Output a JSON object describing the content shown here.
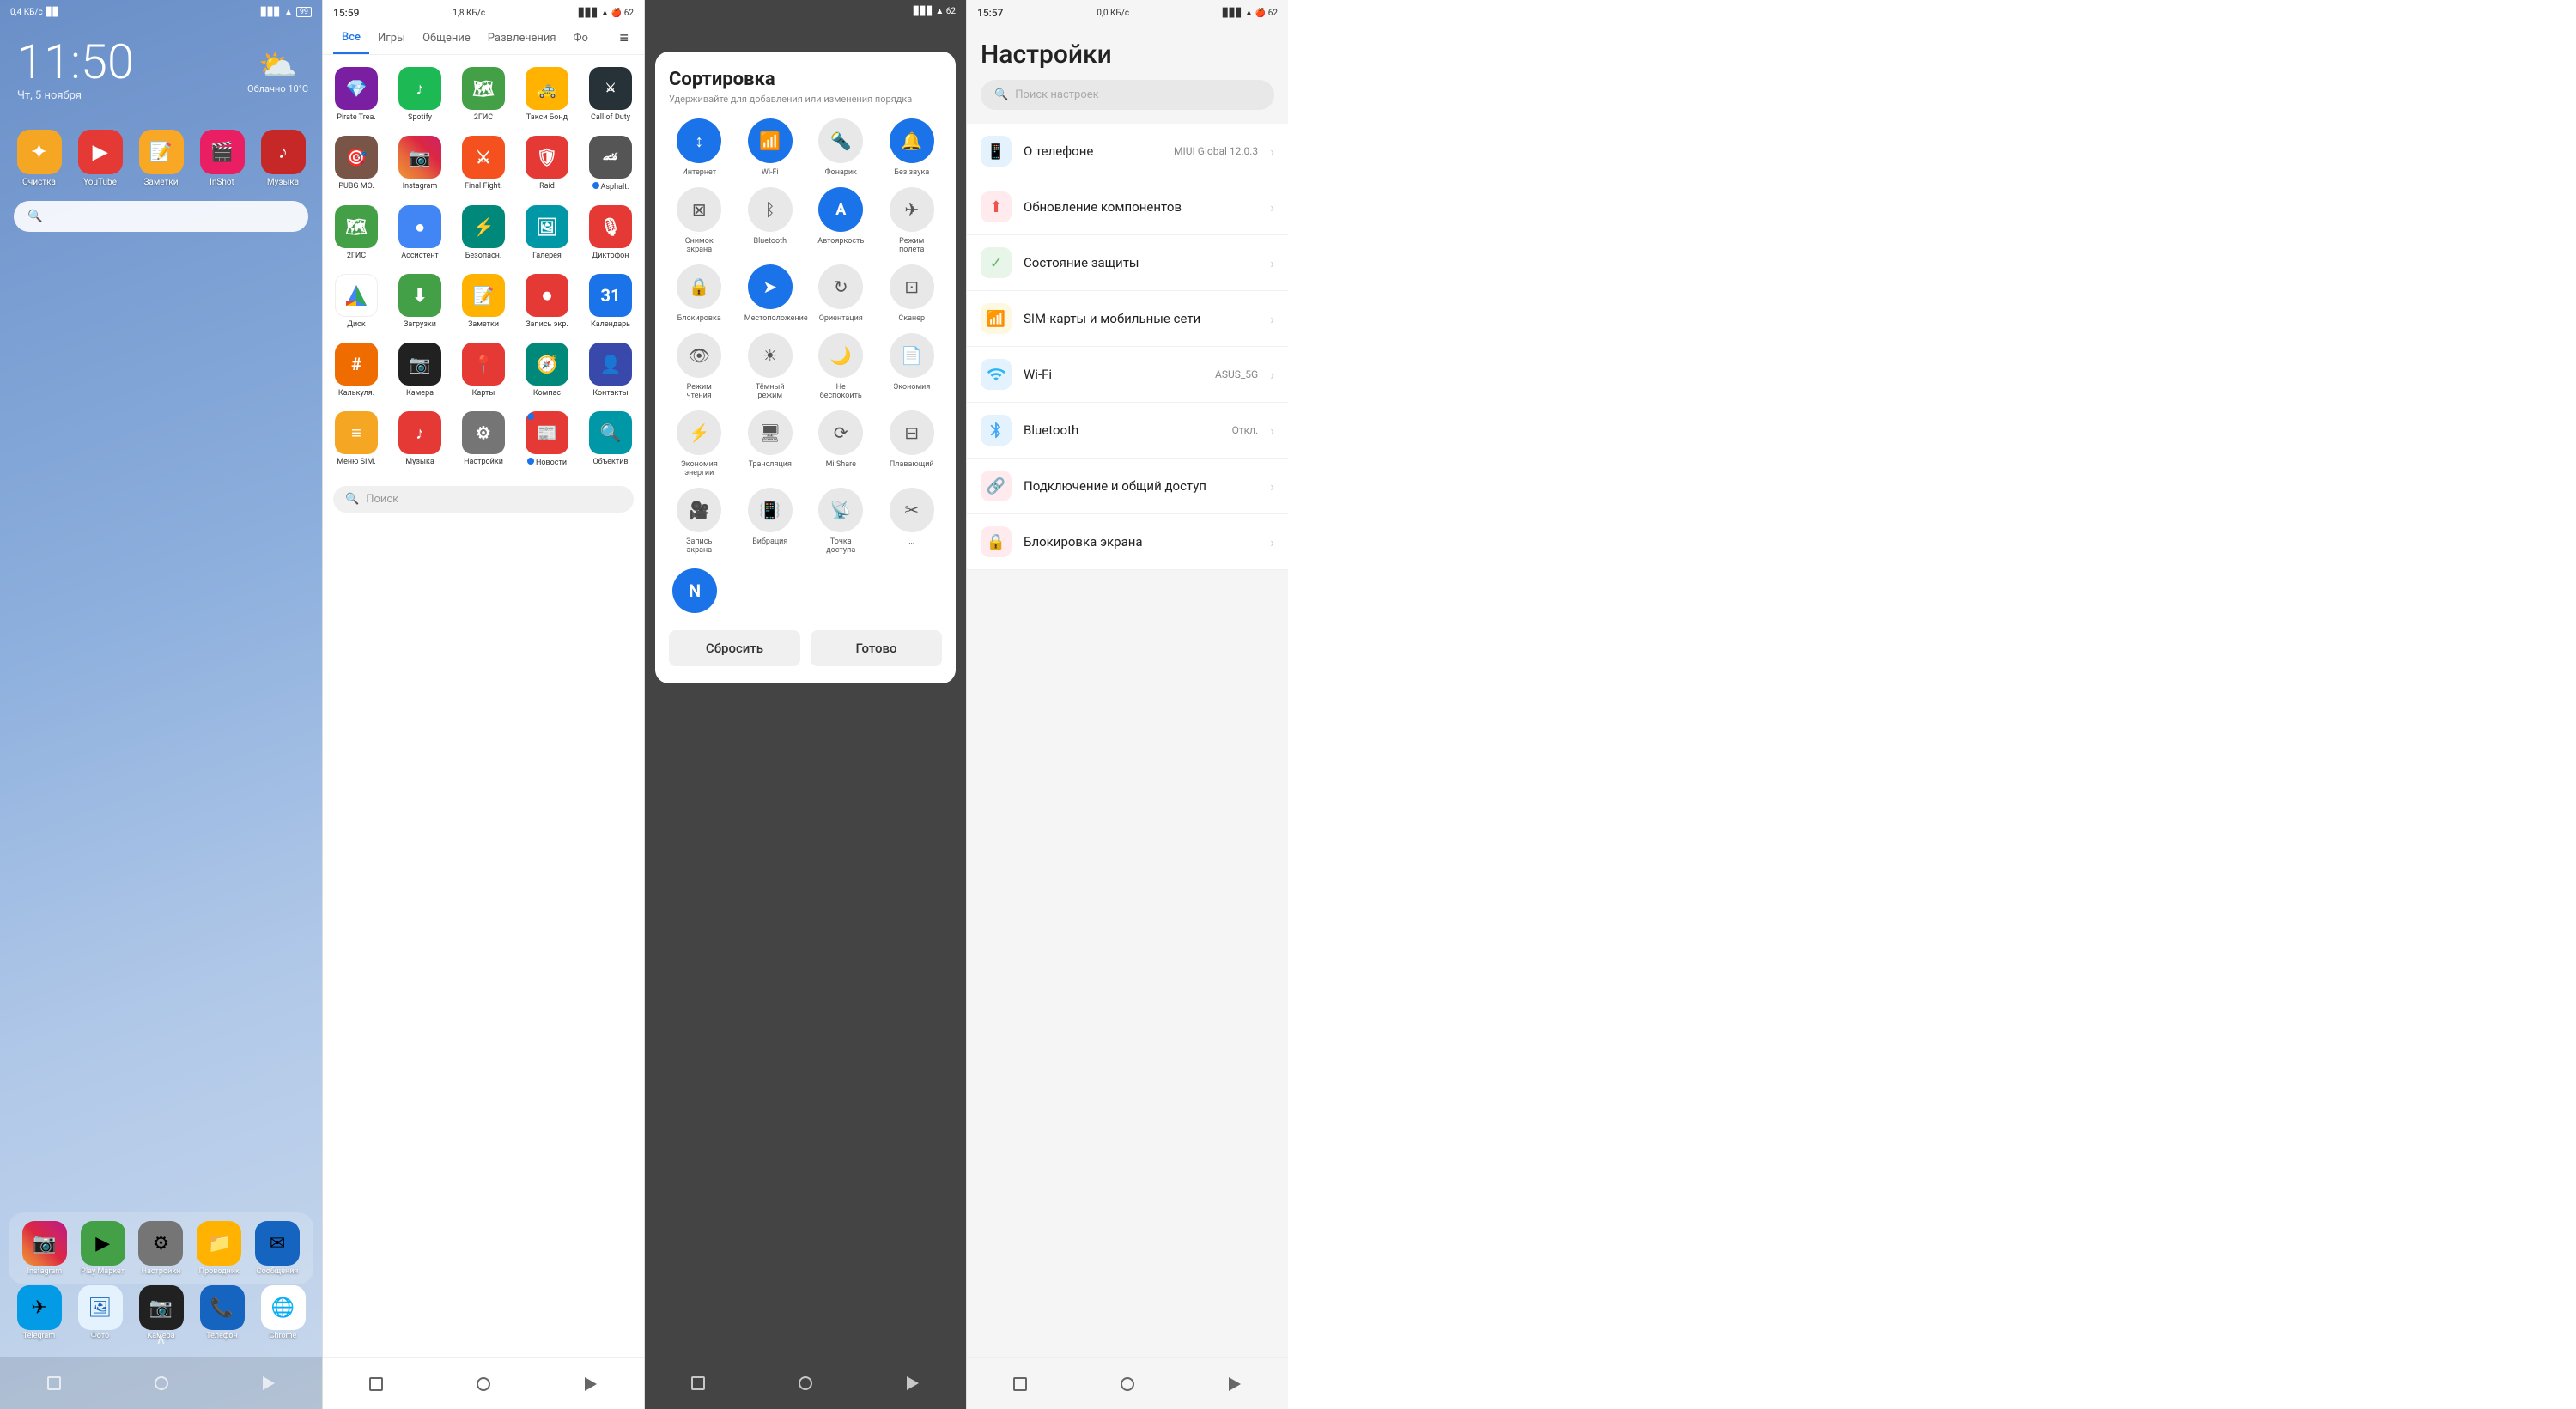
{
  "screen1": {
    "statusBar": {
      "left": "0,4 КБ/с",
      "time": "11:50",
      "date": "Чт, 5 ноября",
      "weather": "Облачно 10°C"
    },
    "clock": "11:50",
    "date": "Чт, 5 ноября",
    "weather": {
      "icon": "⛅",
      "text": "Облачно 10°C"
    },
    "apps": [
      {
        "name": "Очистка",
        "color": "icon-orange",
        "icon": "✦"
      },
      {
        "name": "YouTube",
        "color": "icon-red",
        "icon": "▶"
      },
      {
        "name": "Заметки",
        "color": "icon-yellow",
        "icon": "📝"
      },
      {
        "name": "InShot",
        "color": "icon-pink-red",
        "icon": "🎬"
      },
      {
        "name": "Музыка",
        "color": "icon-dark-red",
        "icon": "♪"
      }
    ],
    "searchPlaceholder": "🔍",
    "dock": [
      {
        "name": "Instagram",
        "color": "icon-pink-red",
        "icon": "📷"
      },
      {
        "name": "Play Маркет",
        "color": "icon-green",
        "icon": "▶"
      },
      {
        "name": "Настройки",
        "color": "icon-grey",
        "icon": "⚙"
      },
      {
        "name": "Проводник",
        "color": "icon-amber",
        "icon": "📁"
      },
      {
        "name": "Сообщения",
        "color": "icon-blue",
        "icon": "✉"
      }
    ],
    "bottom": [
      {
        "name": "Telegram",
        "color": "icon-light-blue",
        "icon": "✈"
      },
      {
        "name": "Фото",
        "color": "icon-blue",
        "icon": "🖼"
      },
      {
        "name": "Камера",
        "color": "icon-grey",
        "icon": "📷"
      },
      {
        "name": "Телефон",
        "color": "icon-blue",
        "icon": "📞"
      },
      {
        "name": "Chrome",
        "color": "icon-red",
        "icon": "🌐"
      }
    ]
  },
  "screen2": {
    "statusBar": {
      "time": "15:59",
      "traffic": "1,8 КБ/с"
    },
    "tabs": [
      {
        "label": "Все",
        "active": true
      },
      {
        "label": "Игры",
        "active": false
      },
      {
        "label": "Общение",
        "active": false
      },
      {
        "label": "Развлечения",
        "active": false
      },
      {
        "label": "Фо",
        "active": false
      }
    ],
    "apps": [
      {
        "name": "Pirate Trea.",
        "color": "icon-purple",
        "icon": "💎"
      },
      {
        "name": "Spotify",
        "color": "icon-spotify",
        "icon": "♪"
      },
      {
        "name": "2ГИС",
        "color": "icon-green",
        "icon": "🗺"
      },
      {
        "name": "Такси Бонд",
        "color": "icon-amber",
        "icon": "🚕"
      },
      {
        "name": "Call of Duty",
        "color": "icon-dark-green",
        "icon": "🎮"
      },
      {
        "name": "PUBG MO.",
        "color": "icon-brown",
        "icon": "🎯"
      },
      {
        "name": "Instagram",
        "color": "icon-pink-red",
        "icon": "📷"
      },
      {
        "name": "Final Fight.",
        "color": "icon-deep-orange",
        "icon": "⚔"
      },
      {
        "name": "Raid",
        "color": "icon-red",
        "icon": "🛡"
      },
      {
        "name": "• Asphalt.",
        "color": "icon-grey",
        "icon": "🏎"
      },
      {
        "name": "2ГИС",
        "color": "icon-green",
        "icon": "🗺"
      },
      {
        "name": "Ассистент",
        "color": "icon-indigo",
        "icon": "●"
      },
      {
        "name": "Безопасн.",
        "color": "icon-teal",
        "icon": "⚡"
      },
      {
        "name": "Галерея",
        "color": "icon-cyan",
        "icon": "🖼"
      },
      {
        "name": "Диктофон",
        "color": "icon-red",
        "icon": "🎙"
      },
      {
        "name": "Диск",
        "color": "icon-green",
        "icon": "△"
      },
      {
        "name": "Загрузки",
        "color": "icon-green",
        "icon": "⬇"
      },
      {
        "name": "Заметки",
        "color": "icon-amber",
        "icon": "📝"
      },
      {
        "name": "Запись экр.",
        "color": "icon-red",
        "icon": "⏺"
      },
      {
        "name": "Календарь",
        "color": "icon-blue",
        "icon": "31"
      },
      {
        "name": "Калькуля.",
        "color": "icon-orange-deep",
        "icon": "#"
      },
      {
        "name": "Камера",
        "color": "icon-grey",
        "icon": "📷"
      },
      {
        "name": "Карты",
        "color": "icon-red",
        "icon": "📍"
      },
      {
        "name": "Компас",
        "color": "icon-teal",
        "icon": "🧭"
      },
      {
        "name": "Контакты",
        "color": "icon-indigo",
        "icon": "👤"
      },
      {
        "name": "Меню SIM.",
        "color": "icon-orange",
        "icon": "≡"
      },
      {
        "name": "Музыка",
        "color": "icon-red",
        "icon": "♪"
      },
      {
        "name": "Настройки",
        "color": "icon-grey",
        "icon": "⚙"
      },
      {
        "name": "• Новости",
        "color": "icon-red",
        "icon": "📰"
      },
      {
        "name": "Объектив",
        "color": "icon-cyan",
        "icon": "🔍"
      }
    ],
    "searchPlaceholder": "Поиск"
  },
  "screen3": {
    "title": "Сортировка",
    "subtitle": "Удерживайте для добавления или изменения порядка",
    "tiles": [
      {
        "label": "Интернет",
        "active": true,
        "icon": "↕"
      },
      {
        "label": "Wi-Fi",
        "active": true,
        "icon": "📶"
      },
      {
        "label": "Фонарик",
        "active": false,
        "icon": "🔦"
      },
      {
        "label": "Без звука",
        "active": true,
        "icon": "🔔"
      },
      {
        "label": "Снимок экрана",
        "active": false,
        "icon": "⊠"
      },
      {
        "label": "Bluetooth",
        "active": false,
        "icon": "ᛒ"
      },
      {
        "label": "Автояркость",
        "active": true,
        "icon": "A"
      },
      {
        "label": "Режим полета",
        "active": false,
        "icon": "✈"
      },
      {
        "label": "Блокировка",
        "active": false,
        "icon": "🔒"
      },
      {
        "label": "Местоположение",
        "active": true,
        "icon": "➤"
      },
      {
        "label": "Ориентация",
        "active": false,
        "icon": "↻"
      },
      {
        "label": "Сканер",
        "active": false,
        "icon": "⊡"
      },
      {
        "label": "Режим чтения",
        "active": false,
        "icon": "👁"
      },
      {
        "label": "Тёмный режим",
        "active": false,
        "icon": "☀"
      },
      {
        "label": "Не беспокоить",
        "active": false,
        "icon": "🌙"
      },
      {
        "label": "Экономия",
        "active": false,
        "icon": "📄"
      },
      {
        "label": "Экономия энергии",
        "active": false,
        "icon": "⚡"
      },
      {
        "label": "Трансляция",
        "active": false,
        "icon": "🖥"
      },
      {
        "label": "Mi Share",
        "active": false,
        "icon": "⟳"
      },
      {
        "label": "Плавающий",
        "active": false,
        "icon": "⊟"
      },
      {
        "label": "Запись экрана",
        "active": false,
        "icon": "🎥"
      },
      {
        "label": "Вибрация",
        "active": false,
        "icon": "📳"
      },
      {
        "label": "Точка доступа",
        "active": false,
        "icon": "📡"
      },
      {
        "label": "...",
        "active": false,
        "icon": "✂"
      }
    ],
    "buttons": {
      "reset": "Сбросить",
      "done": "Готово"
    },
    "nfc_tile": {
      "label": "N",
      "active": true
    }
  },
  "screen4": {
    "statusBar": {
      "time": "15:57",
      "traffic": "0,0 КБ/с"
    },
    "title": "Настройки",
    "searchPlaceholder": "Поиск настроек",
    "items": [
      {
        "icon": "📱",
        "iconColor": "#4fc3f7",
        "title": "О телефоне",
        "subtitle": "",
        "value": "MIUI Global 12.0.3"
      },
      {
        "icon": "⬆",
        "iconColor": "#ef5350",
        "title": "Обновление компонентов",
        "subtitle": "",
        "value": ""
      },
      {
        "icon": "✓",
        "iconColor": "#66bb6a",
        "title": "Состояние защиты",
        "subtitle": "",
        "value": ""
      },
      {
        "icon": "📶",
        "iconColor": "#ffa726",
        "title": "SIM-карты и мобильные сети",
        "subtitle": "",
        "value": ""
      },
      {
        "icon": "📡",
        "iconColor": "#29b6f6",
        "title": "Wi-Fi",
        "subtitle": "",
        "value": "ASUS_5G"
      },
      {
        "icon": "ᛒ",
        "iconColor": "#42a5f5",
        "title": "Bluetooth",
        "subtitle": "",
        "value": "Откл."
      },
      {
        "icon": "🔗",
        "iconColor": "#ef5350",
        "title": "Подключение и общий доступ",
        "subtitle": "",
        "value": ""
      },
      {
        "icon": "🔒",
        "iconColor": "#ef5350",
        "title": "Блокировка экрана",
        "subtitle": "",
        "value": ""
      }
    ]
  }
}
